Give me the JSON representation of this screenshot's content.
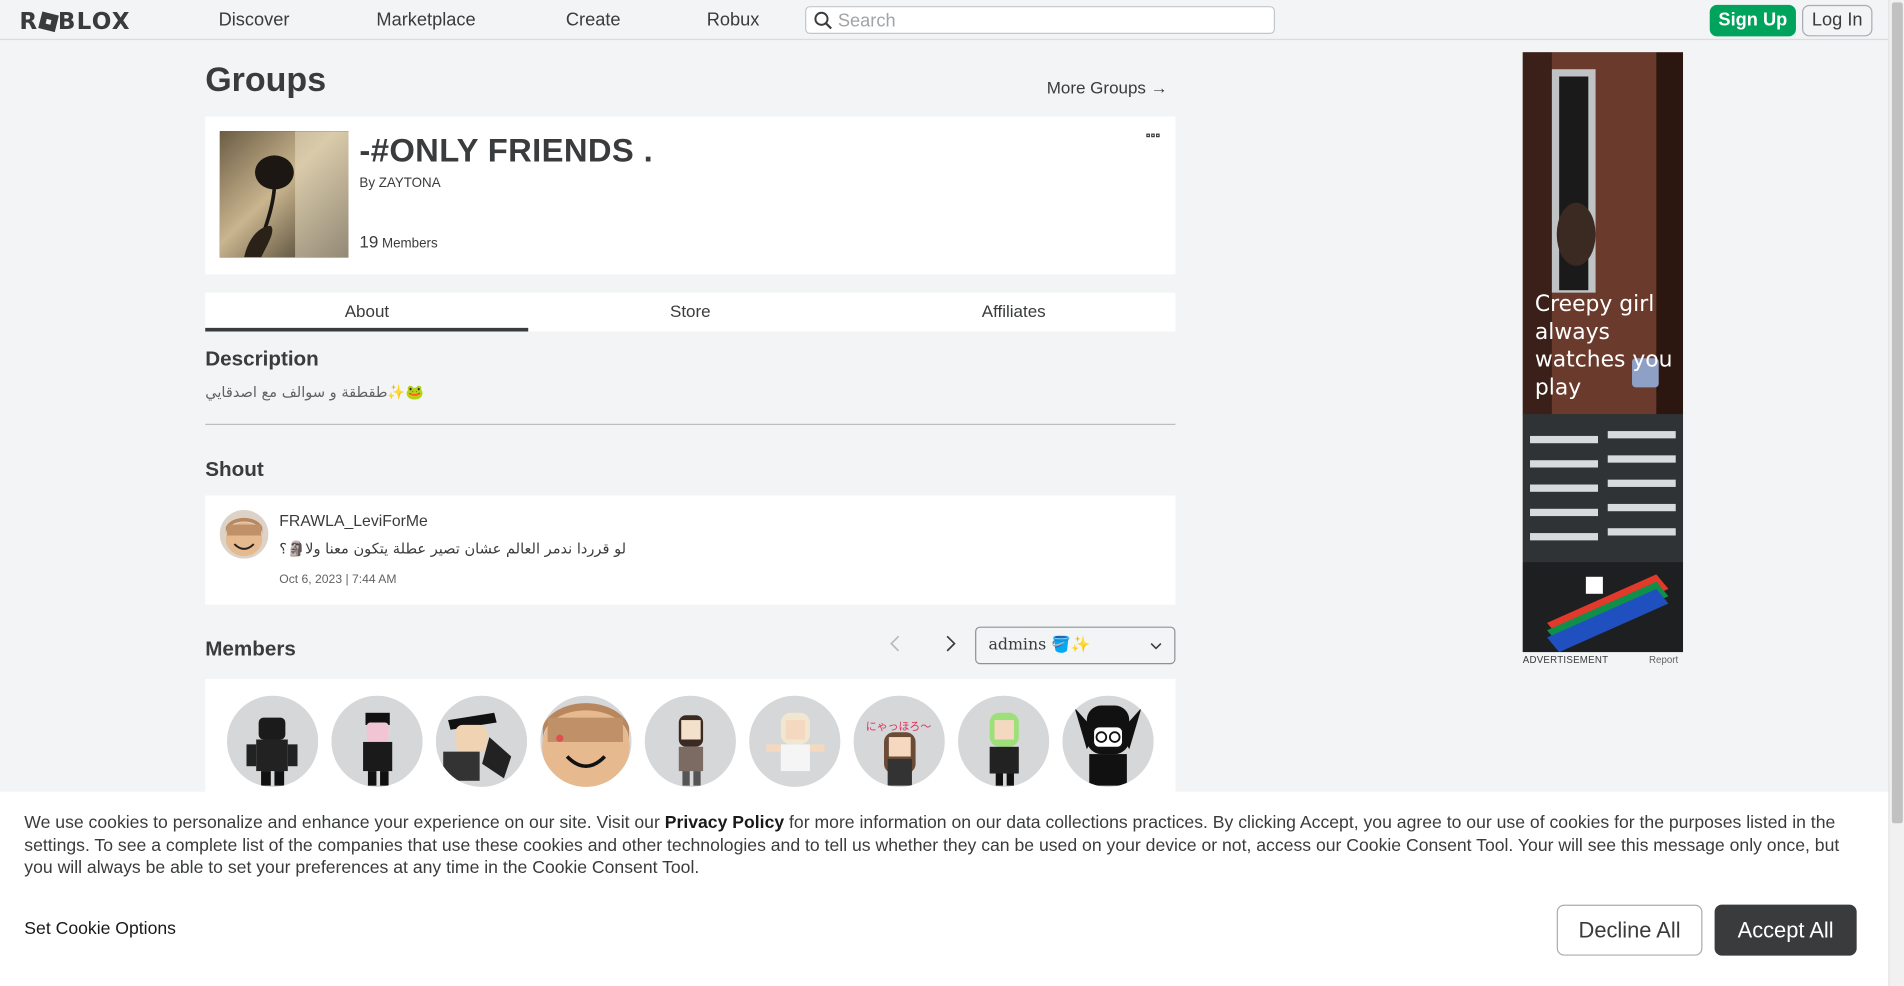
{
  "nav": {
    "logo": "ROBLOX",
    "links": [
      "Discover",
      "Marketplace",
      "Create",
      "Robux"
    ],
    "search_placeholder": "Search",
    "signup": "Sign Up",
    "login": "Log In"
  },
  "page": {
    "title": "Groups",
    "more_groups": "More Groups →"
  },
  "group": {
    "name": "-#ONLY FRIENDS .",
    "by_prefix": "By",
    "owner": "ZAYTONA",
    "member_count": "19",
    "members_label": "Members"
  },
  "tabs": [
    "About",
    "Store",
    "Affiliates"
  ],
  "description": {
    "heading": "Description",
    "text": "🐸✨طقطقة و سوالف مع اصدقايي"
  },
  "shout": {
    "heading": "Shout",
    "user": "FRAWLA_LeviForMe",
    "text": "لو قرردا ندمر العالم عشان تصير عطلة يتكون معنا ولا🗿؟",
    "date": "Oct 6, 2023 | 7:44 AM"
  },
  "members": {
    "heading": "Members",
    "role_selected": "admins 🪣✨",
    "avatar_count": 9
  },
  "ad": {
    "text": "Creepy girl always watches you play",
    "label": "ADVERTISEMENT",
    "report": "Report"
  },
  "cookie": {
    "text_before": "We use cookies to personalize and enhance your experience on our site. Visit our ",
    "policy_link": "Privacy Policy",
    "text_after": " for more information on our data collections practices. By clicking Accept, you agree to our use of cookies for the purposes listed in the settings. To see a complete list of the companies that use these cookies and other technologies and to tell us whether they can be used on your device or not, access our Cookie Consent Tool. Your will see this message only once, but you will always be able to set your preferences at any time in the Cookie Consent Tool.",
    "set_options": "Set Cookie Options",
    "decline": "Decline All",
    "accept": "Accept All"
  },
  "colors": {
    "signup_green": "#00a35b",
    "accept_dark": "#393b3d",
    "page_bg": "#f2f4f5"
  }
}
